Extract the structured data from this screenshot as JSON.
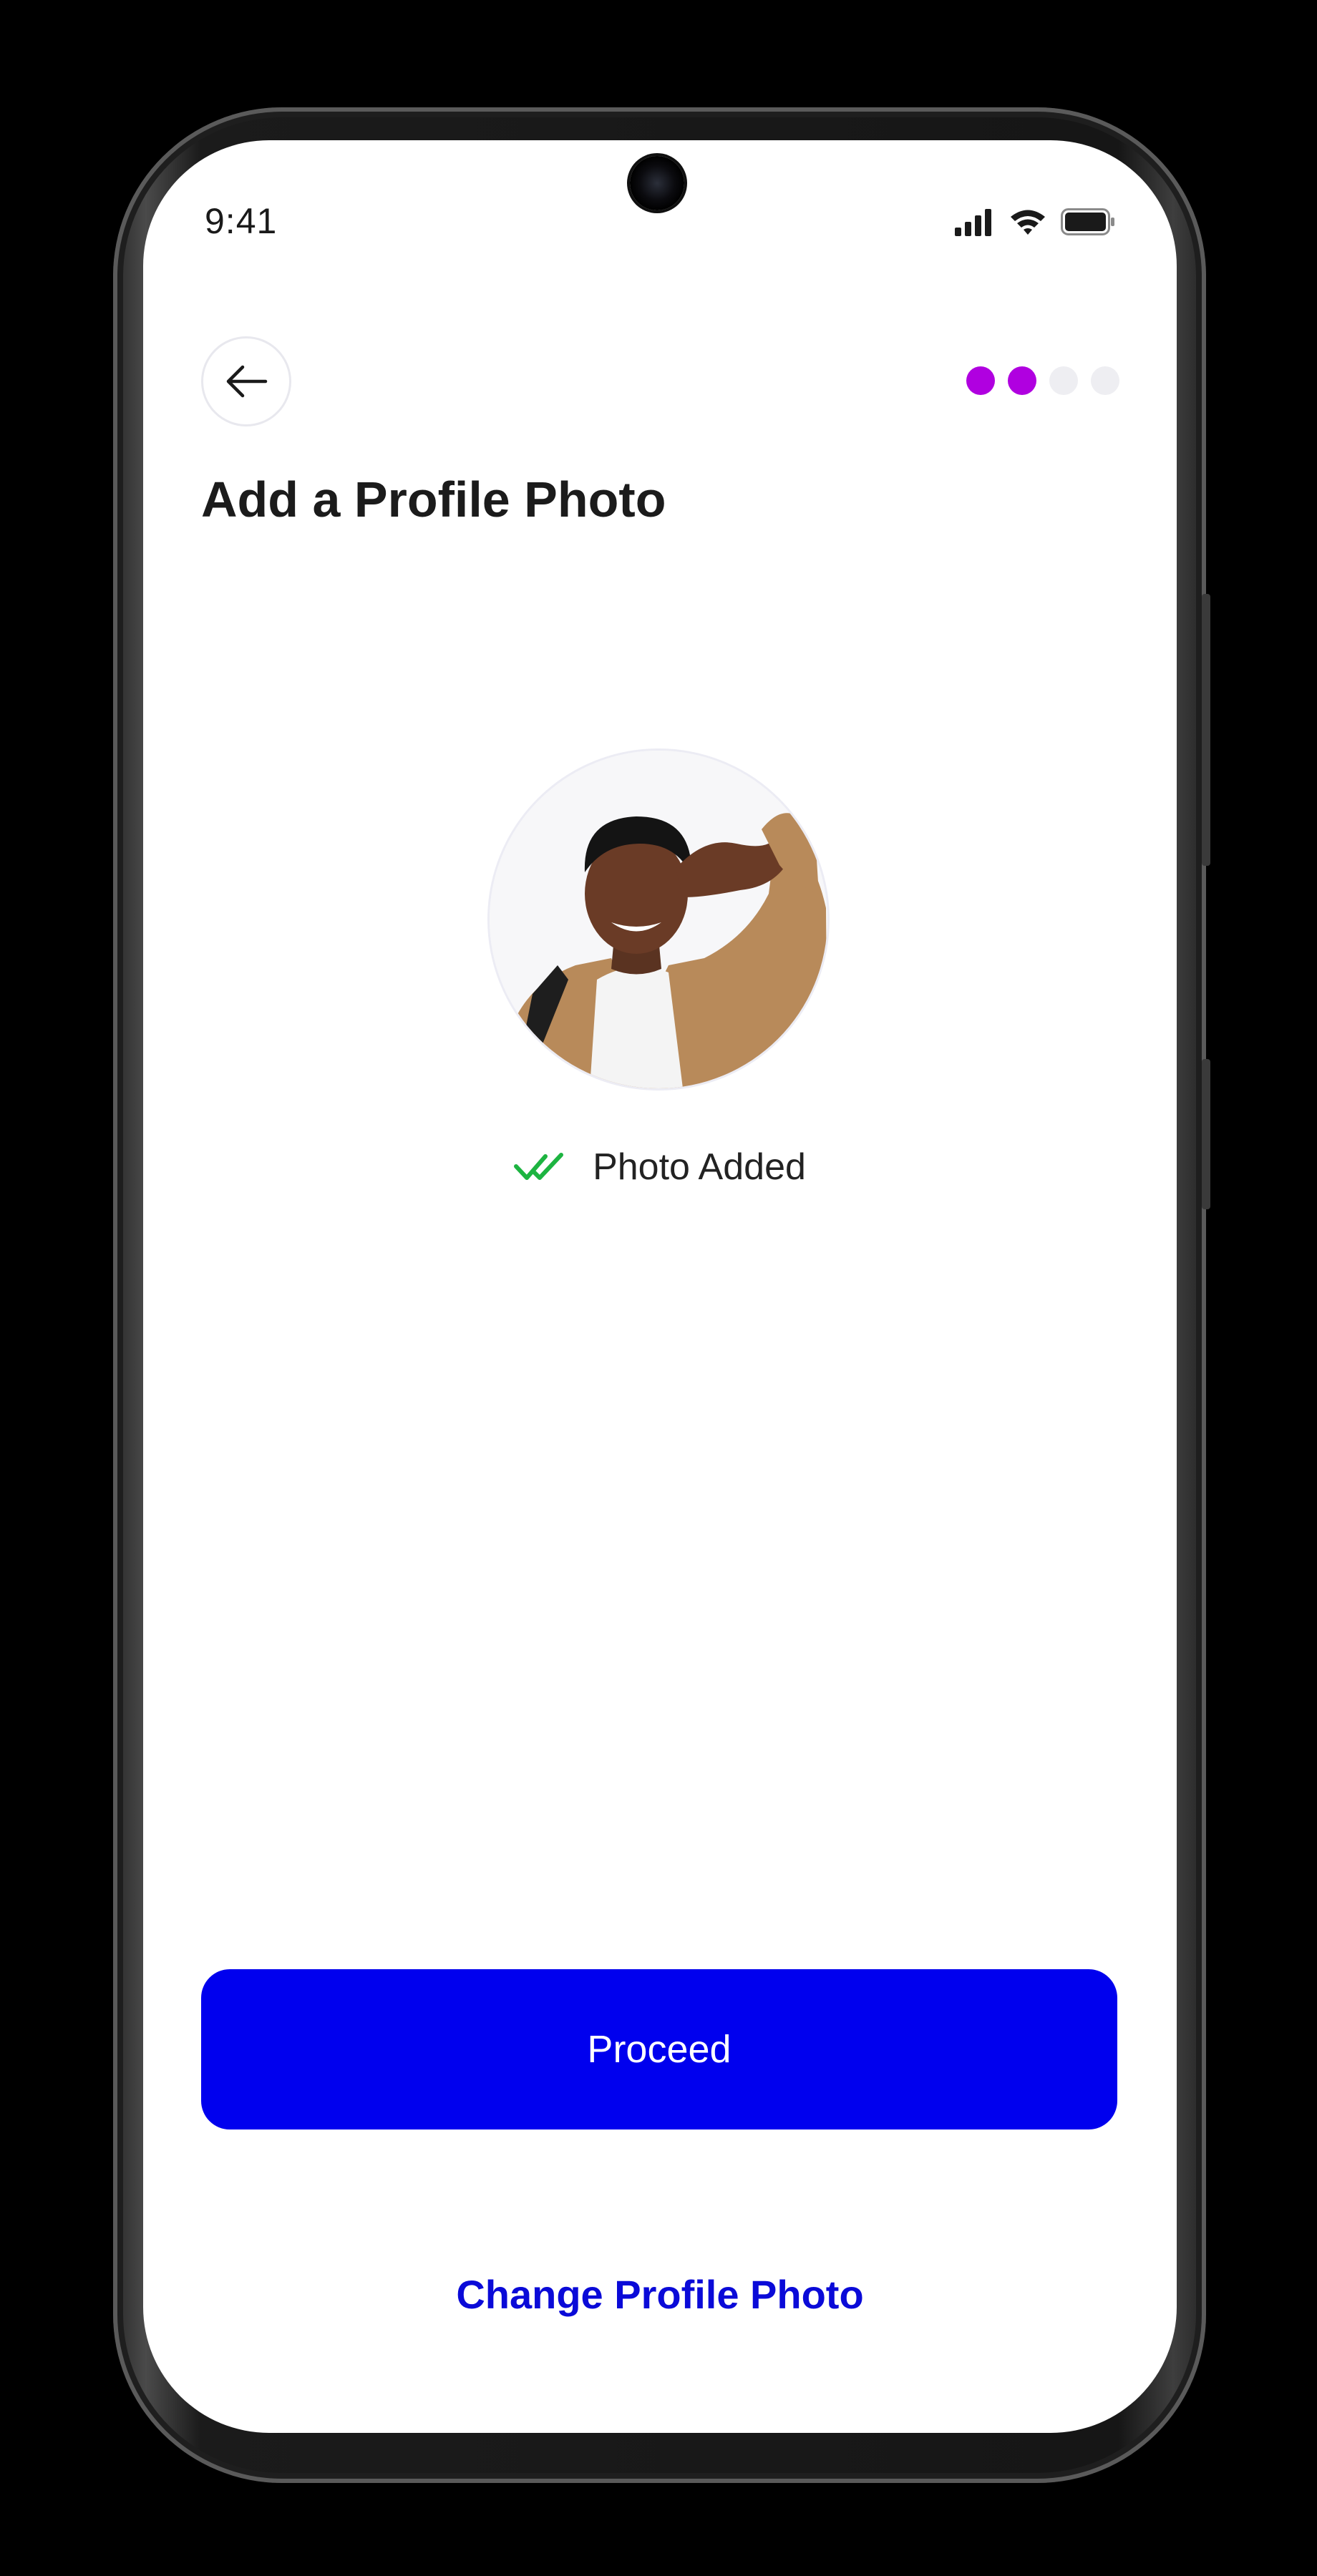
{
  "status_bar": {
    "time": "9:41"
  },
  "header": {
    "title": "Add a Profile Photo"
  },
  "progress": {
    "steps_total": 4,
    "steps_done": 2,
    "active_color": "#B000E0",
    "inactive_color": "#EEEEF2"
  },
  "photo": {
    "status_text": "Photo Added",
    "status_color": "#1DB441"
  },
  "actions": {
    "proceed_label": "Proceed",
    "change_label": "Change Profile Photo",
    "primary_color": "#0000EE"
  }
}
